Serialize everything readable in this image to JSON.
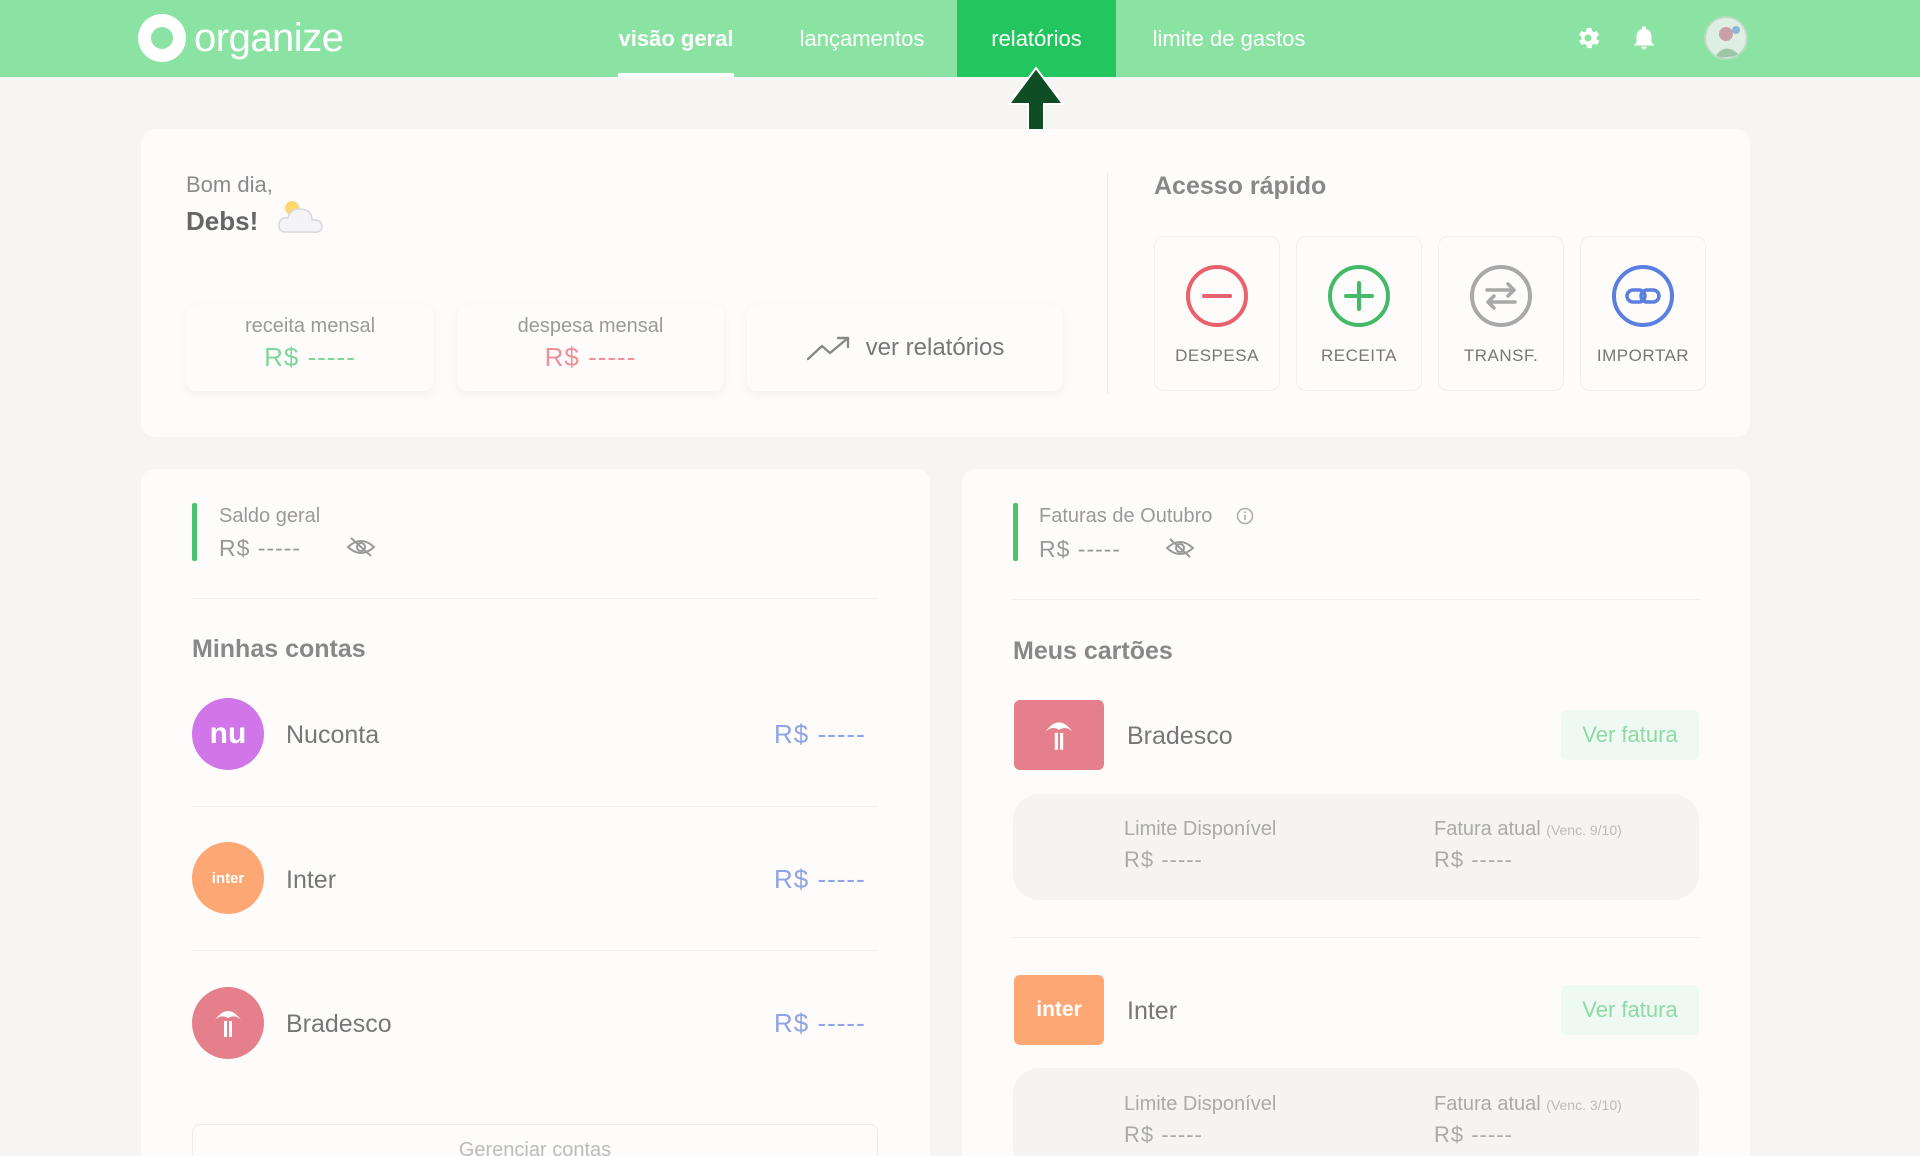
{
  "app": {
    "logo_text": "organize"
  },
  "nav": {
    "overview": "visão geral",
    "entries": "lançamentos",
    "reports": "relatórios",
    "spend_limit": "limite de gastos"
  },
  "greeting": {
    "line1": "Bom dia,",
    "name": "Debs!"
  },
  "stats": {
    "income_label": "receita mensal",
    "income_value": "R$ -----",
    "expense_label": "despesa mensal",
    "expense_value": "R$ -----",
    "reports_link": "ver relatórios"
  },
  "quick_access": {
    "title": "Acesso rápido",
    "items": [
      {
        "label": "DESPESA",
        "icon": "minus-circle-icon",
        "color": "#e8616c"
      },
      {
        "label": "RECEITA",
        "icon": "plus-circle-icon",
        "color": "#45b968"
      },
      {
        "label": "TRANSF.",
        "icon": "transfer-icon",
        "color": "#a8a8a8"
      },
      {
        "label": "IMPORTAR",
        "icon": "link-icon",
        "color": "#5b7fe0"
      }
    ]
  },
  "balance": {
    "label": "Saldo geral",
    "value": "R$ -----"
  },
  "accounts": {
    "title": "Minhas contas",
    "items": [
      {
        "name": "Nuconta",
        "logo_text": "nu",
        "color": "#d076e8",
        "value": "R$ -----"
      },
      {
        "name": "Inter",
        "logo_text": "inter",
        "color": "#fda874",
        "value": "R$ -----"
      },
      {
        "name": "Bradesco",
        "logo_text": "",
        "color": "#e57f8b",
        "value": "R$ -----"
      }
    ],
    "manage_label": "Gerenciar contas"
  },
  "invoices": {
    "label": "Faturas de Outubro",
    "value": "R$ -----"
  },
  "cards": {
    "title": "Meus cartões",
    "items": [
      {
        "name": "Bradesco",
        "logo_text": "",
        "color": "#e57f8b",
        "action": "Ver fatura",
        "limit_label": "Limite Disponível",
        "limit_value": "R$ -----",
        "invoice_label": "Fatura atual",
        "invoice_due": "(Venc. 9/10)",
        "invoice_value": "R$ -----"
      },
      {
        "name": "Inter",
        "logo_text": "inter",
        "color": "#fda874",
        "action": "Ver fatura",
        "limit_label": "Limite Disponível",
        "limit_value": "R$ -----",
        "invoice_label": "Fatura atual",
        "invoice_due": "(Venc. 3/10)",
        "invoice_value": "R$ -----"
      }
    ]
  },
  "colors": {
    "header": "#8ae3a2",
    "active_tab": "#22c55e",
    "arrow": "#0f4d25"
  }
}
